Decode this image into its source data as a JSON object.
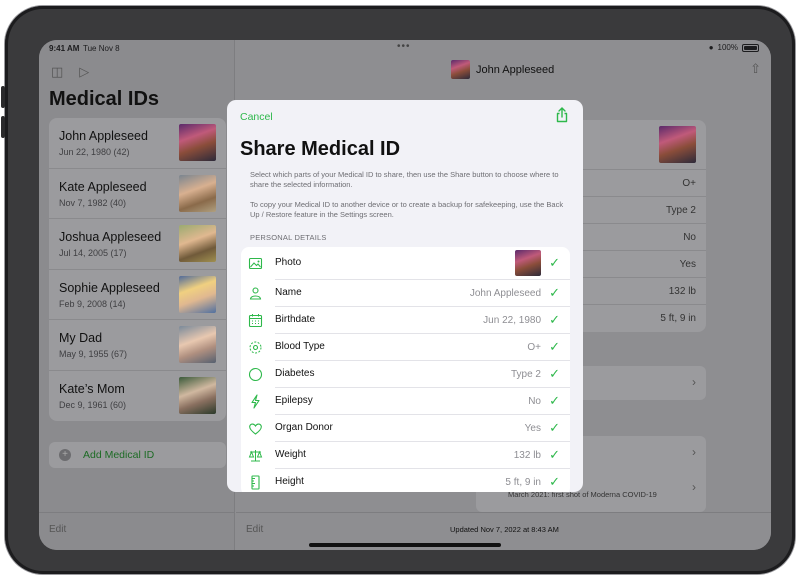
{
  "status_bar": {
    "time": "9:41 AM",
    "date": "Tue Nov 8",
    "battery": "100%"
  },
  "sidebar": {
    "title": "Medical IDs",
    "items": [
      {
        "name": "John Appleseed",
        "date": "Jun 22, 1980 (42)"
      },
      {
        "name": "Kate Appleseed",
        "date": "Nov 7, 1982 (40)"
      },
      {
        "name": "Joshua Appleseed",
        "date": "Jul 14, 2005 (17)"
      },
      {
        "name": "Sophie Appleseed",
        "date": "Feb 9, 2008 (14)"
      },
      {
        "name": "My Dad",
        "date": "May 9, 1955 (67)"
      },
      {
        "name": "Kate’s Mom",
        "date": "Dec 9, 1961 (60)"
      }
    ],
    "add_label": "Add Medical ID",
    "edit_label": "Edit"
  },
  "detail": {
    "title": "John Appleseed",
    "rows": [
      "O+",
      "Type 2",
      "No",
      "Yes",
      "132 lb",
      "5 ft, 9 in"
    ],
    "covid_note": "March 2021: first shot of Moderna COVID-19",
    "edit_label": "Edit",
    "updated": "Updated Nov 7, 2022 at 8:43 AM"
  },
  "sheet": {
    "cancel_label": "Cancel",
    "title": "Share Medical ID",
    "description": "Select which parts of your Medical ID to share, then use the Share button to choose where to share the selected information.",
    "description2": "To copy your Medical ID to another device or to create a backup for safekeeping, use the Back Up / Restore feature in the Settings screen.",
    "section_header": "PERSONAL DETAILS",
    "rows": [
      {
        "label": "Photo",
        "value": "",
        "icon": "photo-icon"
      },
      {
        "label": "Name",
        "value": "John Appleseed",
        "icon": "person-icon"
      },
      {
        "label": "Birthdate",
        "value": "Jun 22, 1980",
        "icon": "calendar-icon"
      },
      {
        "label": "Blood Type",
        "value": "O+",
        "icon": "blood-type-icon"
      },
      {
        "label": "Diabetes",
        "value": "Type 2",
        "icon": "circle-icon"
      },
      {
        "label": "Epilepsy",
        "value": "No",
        "icon": "bolt-icon"
      },
      {
        "label": "Organ Donor",
        "value": "Yes",
        "icon": "heart-icon"
      },
      {
        "label": "Weight",
        "value": "132 lb",
        "icon": "scale-icon"
      },
      {
        "label": "Height",
        "value": "5 ft, 9 in",
        "icon": "ruler-icon"
      }
    ],
    "check": "✓"
  },
  "colors": {
    "accent": "#2eb84b",
    "dim_overlay": "#8e8e91"
  }
}
